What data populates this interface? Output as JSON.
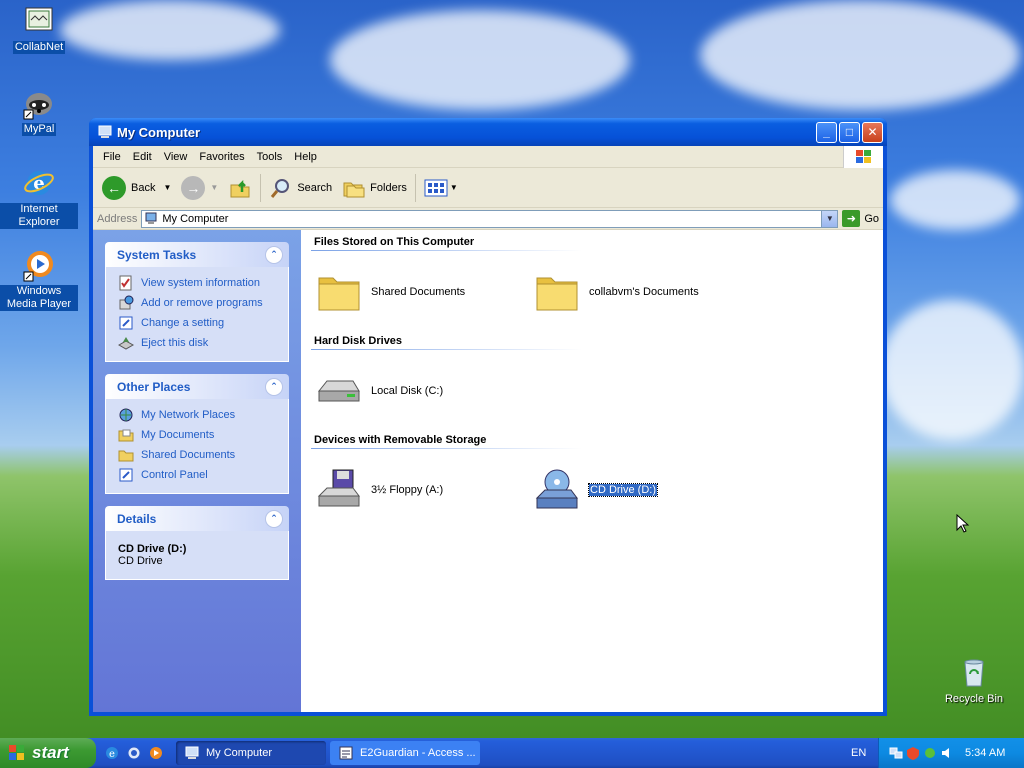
{
  "desktop": {
    "icons": [
      {
        "label": "CollabNet",
        "icon": "collabnet-icon"
      },
      {
        "label": "MyPal",
        "icon": "mypal-raccoon-icon"
      },
      {
        "label": "Internet Explorer",
        "icon": "internet-explorer-icon"
      },
      {
        "label": "Windows Media Player",
        "icon": "media-player-icon"
      },
      {
        "label": "Recycle Bin",
        "icon": "recycle-bin-icon"
      }
    ]
  },
  "window": {
    "title": "My Computer",
    "menu": [
      "File",
      "Edit",
      "View",
      "Favorites",
      "Tools",
      "Help"
    ],
    "toolbar": {
      "back": "Back",
      "search": "Search",
      "folders": "Folders"
    },
    "address": {
      "label": "Address",
      "value": "My Computer",
      "go": "Go"
    },
    "taskpane": {
      "system_tasks": {
        "title": "System Tasks",
        "links": [
          "View system information",
          "Add or remove programs",
          "Change a setting",
          "Eject this disk"
        ]
      },
      "other_places": {
        "title": "Other Places",
        "links": [
          "My Network Places",
          "My Documents",
          "Shared Documents",
          "Control Panel"
        ]
      },
      "details": {
        "title": "Details",
        "item_name": "CD Drive (D:)",
        "item_type": "CD Drive"
      }
    },
    "groups": [
      {
        "title": "Files Stored on This Computer",
        "items": [
          "Shared Documents",
          "collabvm's Documents"
        ]
      },
      {
        "title": "Hard Disk Drives",
        "items": [
          "Local Disk (C:)"
        ]
      },
      {
        "title": "Devices with Removable Storage",
        "items": [
          "3½ Floppy (A:)",
          "CD Drive (D:)"
        ]
      }
    ]
  },
  "taskbar": {
    "start": "start",
    "tasks": [
      "My Computer",
      "E2Guardian - Access ..."
    ],
    "language": "EN",
    "clock": "5:34 AM"
  }
}
